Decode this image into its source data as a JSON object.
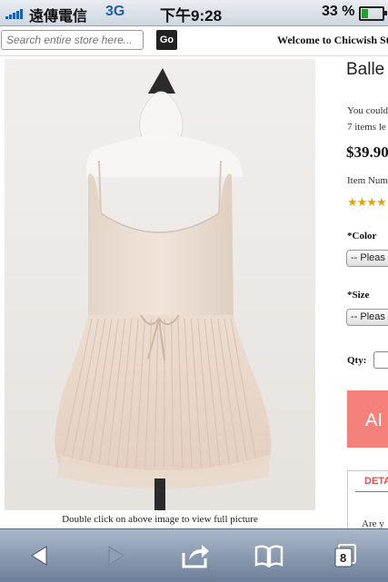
{
  "status_bar": {
    "carrier": "遠傳電信",
    "network": "3G",
    "time": "下午9:28",
    "battery_percent": "33 %",
    "battery_level": 0.33
  },
  "header": {
    "search_placeholder": "Search entire store here...",
    "go_label": "Go",
    "welcome": "Welcome to Chicwish St"
  },
  "product": {
    "image_caption": "Double click on above image to view full picture",
    "title": "Balle",
    "could_text": "You could",
    "items_left": "7 items le",
    "price": "$39.90",
    "item_number": "Item Num",
    "rating_stars": "★★★★",
    "color_label": "*Color",
    "color_select": "-- Pleas",
    "size_label": "*Size",
    "size_select": "-- Pleas",
    "qty_label": "Qty:",
    "qty_value": "",
    "add_button": "AI",
    "details_tab": "DETA",
    "details_text": "Are y"
  },
  "toolbar": {
    "tab_count": "8",
    "icons": [
      "back-icon",
      "forward-icon",
      "share-icon",
      "bookmarks-icon",
      "pages-icon"
    ]
  },
  "colors": {
    "add_button": "#f5827a",
    "details_accent": "#d9534f",
    "rating": "#e8a200",
    "network": "#1a5fb4",
    "toolbar": "#8a9ab0"
  }
}
